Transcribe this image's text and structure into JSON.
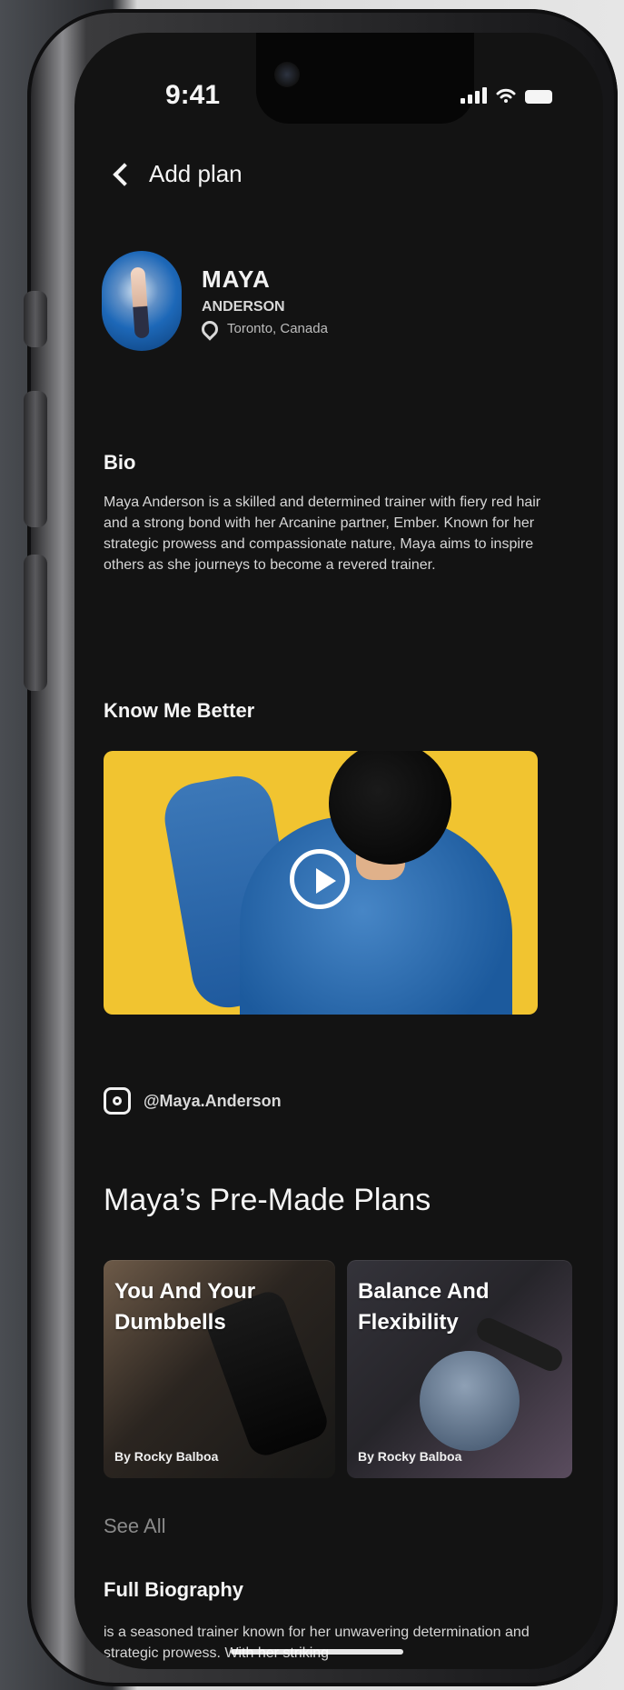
{
  "status": {
    "time": "9:41"
  },
  "header": {
    "back_label": "Add plan"
  },
  "profile": {
    "first_name": "MAYA",
    "last_name": "ANDERSON",
    "location": "Toronto, Canada"
  },
  "sections": {
    "bio_title": "Bio",
    "bio_text": "Maya Anderson is a skilled and determined trainer with fiery red hair and a strong bond with her Arcanine partner, Ember. Known for her strategic prowess and compassionate nature, Maya aims to inspire others as she journeys to become a revered trainer.",
    "know_me_title": "Know Me Better",
    "instagram_handle": "@Maya.Anderson",
    "plans_title": "Maya’s Pre-Made Plans",
    "see_all": "See All",
    "full_bio_title": "Full Biography",
    "full_bio_text": "is a seasoned trainer known for her unwavering determination and strategic prowess. With her striking"
  },
  "plans": [
    {
      "title": "You And Your Dumbbells",
      "author": "By Rocky Balboa"
    },
    {
      "title": "Balance And Flexibility",
      "author": "By Rocky Balboa"
    }
  ],
  "icons": {
    "back": "chevron-left-icon",
    "location": "map-pin-icon",
    "play": "play-icon",
    "instagram": "instagram-icon",
    "signal": "signal-icon",
    "wifi": "wifi-icon",
    "battery": "battery-icon"
  },
  "colors": {
    "background": "#131313",
    "text": "#f5f5f5",
    "muted": "#8a8a8a",
    "accent_video": "#f1c430"
  }
}
